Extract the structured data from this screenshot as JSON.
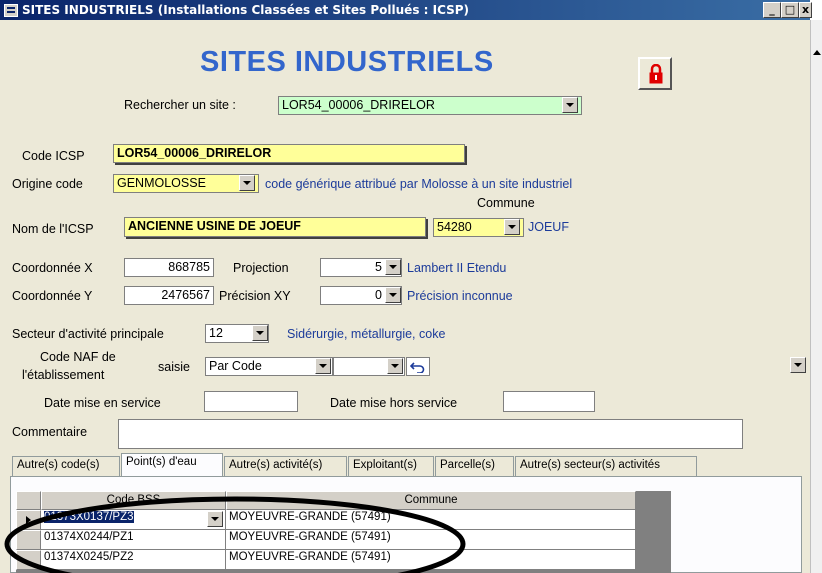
{
  "window": {
    "title": "SITES INDUSTRIELS (Installations Classées et Sites Pollués : ICSP)",
    "minimize": "_",
    "maximize": "□",
    "close": "x"
  },
  "header": {
    "title": "SITES INDUSTRIELS",
    "lock_icon": "padlock-icon",
    "accent_color": "#3366cc"
  },
  "search": {
    "label": "Rechercher un site :",
    "value": "LOR54_00006_DRIRELOR"
  },
  "form": {
    "code_icsp_label": "Code ICSP",
    "code_icsp_value": "LOR54_00006_DRIRELOR",
    "origine_label": "Origine code",
    "origine_value": "GENMOLOSSE",
    "origine_desc": "code générique attribué par Molosse à un site industriel",
    "commune_label": "Commune",
    "nom_label": "Nom de l'ICSP",
    "nom_value": "ANCIENNE USINE DE JOEUF",
    "commune_code": "54280",
    "commune_name": "JOEUF",
    "coord_x_label": "Coordonnée X",
    "coord_x_value": "868785",
    "projection_label": "Projection",
    "projection_value": "5",
    "projection_desc": "Lambert II Etendu",
    "coord_y_label": "Coordonnée Y",
    "coord_y_value": "2476567",
    "precision_label": "Précision XY",
    "precision_value": "0",
    "precision_desc": "Précision inconnue",
    "secteur_label": "Secteur d'activité principale",
    "secteur_value": "12",
    "secteur_desc": "Sidérurgie, métallurgie, coke",
    "naf_label_line1": "Code NAF de",
    "naf_label_line2": "l'établissement",
    "saisie_label": "saisie",
    "saisie_value": "Par Code",
    "naf_value": "",
    "undo_icon": "undo-arrow-icon",
    "date_service_label": "Date mise en service",
    "date_service_value": "",
    "date_hors_label": "Date mise hors service",
    "date_hors_value": "",
    "commentaire_label": "Commentaire",
    "commentaire_value": ""
  },
  "tabs": [
    {
      "label": "Autre(s) code(s)",
      "active": false
    },
    {
      "label": "Point(s) d'eau",
      "active": true
    },
    {
      "label": "Autre(s) activité(s)",
      "active": false
    },
    {
      "label": "Exploitant(s)",
      "active": false
    },
    {
      "label": "Parcelle(s)",
      "active": false
    },
    {
      "label": "Autre(s) secteur(s) activités",
      "active": false
    }
  ],
  "grid": {
    "columns": [
      "Code BSS",
      "Commune"
    ],
    "rows": [
      {
        "code": "01373X0137/PZ3",
        "commune": "MOYEUVRE-GRANDE  (57491)",
        "current": true
      },
      {
        "code": "01374X0244/PZ1",
        "commune": "MOYEUVRE-GRANDE  (57491)",
        "current": false
      },
      {
        "code": "01374X0245/PZ2",
        "commune": "MOYEUVRE-GRANDE  (57491)",
        "current": false
      }
    ]
  }
}
